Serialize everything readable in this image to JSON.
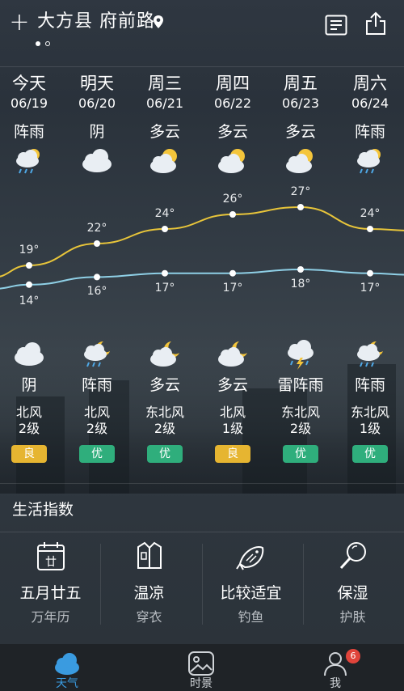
{
  "header": {
    "add_label": "+",
    "city": "大方县 府前路"
  },
  "days": [
    {
      "name": "今天",
      "date": "06/19",
      "weather": "阵雨",
      "icon": "cloud-rain-sun-icon"
    },
    {
      "name": "明天",
      "date": "06/20",
      "weather": "阴",
      "icon": "cloud-icon"
    },
    {
      "name": "周三",
      "date": "06/21",
      "weather": "多云",
      "icon": "cloud-sun-icon"
    },
    {
      "name": "周四",
      "date": "06/22",
      "weather": "多云",
      "icon": "cloud-sun-icon"
    },
    {
      "name": "周五",
      "date": "06/23",
      "weather": "多云",
      "icon": "cloud-sun-icon"
    },
    {
      "name": "周六",
      "date": "06/24",
      "weather": "阵雨",
      "icon": "cloud-rain-sun-icon"
    }
  ],
  "chart_data": {
    "type": "line",
    "categories": [
      "今天",
      "明天",
      "周三",
      "周四",
      "周五",
      "周六"
    ],
    "series": [
      {
        "values": [
          19,
          22,
          24,
          26,
          27,
          24
        ],
        "color": "#e8c53a"
      },
      {
        "values": [
          14,
          16,
          17,
          17,
          18,
          17
        ],
        "color": "#8fd0e6"
      }
    ],
    "labels_high": [
      "19°",
      "22°",
      "24°",
      "26°",
      "27°",
      "24°"
    ],
    "labels_low": [
      "14°",
      "16°",
      "17°",
      "17°",
      "18°",
      "17°"
    ]
  },
  "nights": [
    {
      "weather": "阴",
      "icon": "cloud-icon",
      "wind_dir": "北风",
      "wind_level": "2级",
      "aqi": "良",
      "aqi_color": "#e6b531"
    },
    {
      "weather": "阵雨",
      "icon": "cloud-rain-moon-icon",
      "wind_dir": "北风",
      "wind_level": "2级",
      "aqi": "优",
      "aqi_color": "#2fae7c"
    },
    {
      "weather": "多云",
      "icon": "cloud-moon-icon",
      "wind_dir": "东北风",
      "wind_level": "2级",
      "aqi": "优",
      "aqi_color": "#2fae7c"
    },
    {
      "weather": "多云",
      "icon": "cloud-moon-icon",
      "wind_dir": "北风",
      "wind_level": "1级",
      "aqi": "良",
      "aqi_color": "#e6b531"
    },
    {
      "weather": "雷阵雨",
      "icon": "cloud-thunder-icon",
      "wind_dir": "东北风",
      "wind_level": "2级",
      "aqi": "优",
      "aqi_color": "#2fae7c"
    },
    {
      "weather": "阵雨",
      "icon": "cloud-rain-moon-icon",
      "wind_dir": "东北风",
      "wind_level": "1级",
      "aqi": "优",
      "aqi_color": "#2fae7c"
    }
  ],
  "life": {
    "title": "生活指数",
    "items": [
      {
        "main": "五月廿五",
        "sub": "万年历",
        "icon": "calendar-icon",
        "glyph": "廿"
      },
      {
        "main": "温凉",
        "sub": "穿衣",
        "icon": "shirt-icon"
      },
      {
        "main": "比较适宜",
        "sub": "钓鱼",
        "icon": "fish-icon"
      },
      {
        "main": "保湿",
        "sub": "护肤",
        "icon": "mirror-icon"
      }
    ]
  },
  "tabs": [
    {
      "label": "天气",
      "icon": "cloud-icon",
      "active": true
    },
    {
      "label": "时景",
      "icon": "photo-icon",
      "active": false
    },
    {
      "label": "我",
      "icon": "user-icon",
      "active": false,
      "badge": "6"
    }
  ]
}
